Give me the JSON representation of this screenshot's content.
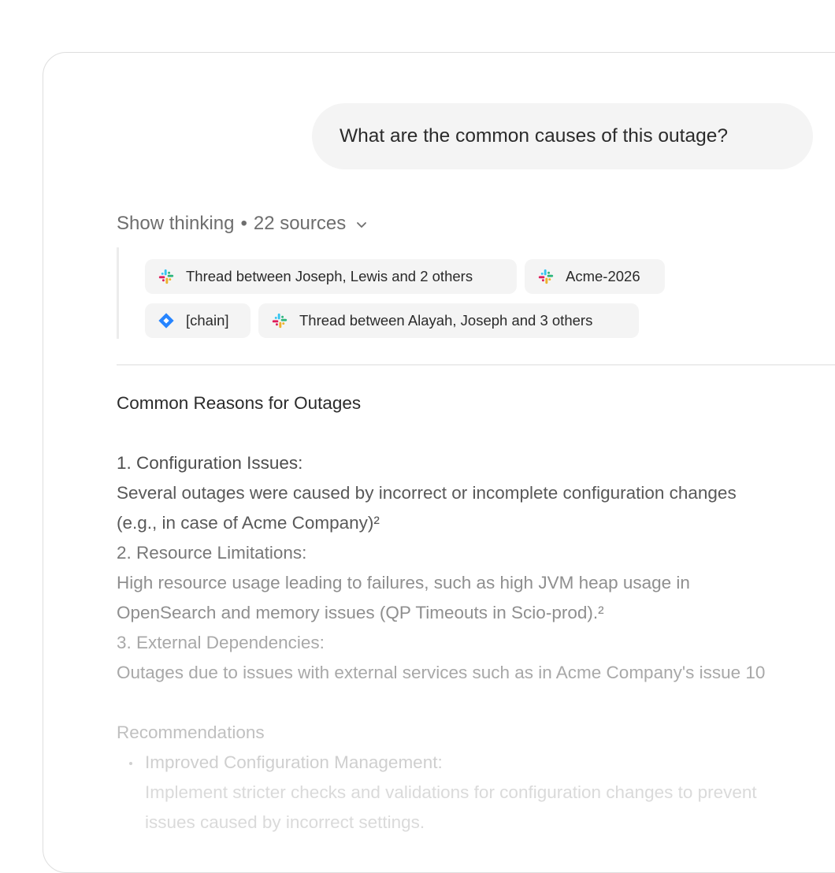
{
  "user_message": "What are the common causes of this outage?",
  "thinking": {
    "label": "Show thinking",
    "separator": "•",
    "sources_count": "22 sources"
  },
  "sources": [
    {
      "label": "Thread between Joseph, Lewis and 2 others",
      "icon": "slack-icon"
    },
    {
      "label": "Acme-2026",
      "icon": "slack-icon"
    },
    {
      "label": "[chain]",
      "icon": "jira-icon"
    },
    {
      "label": "Thread between Alayah, Joseph and 3 others",
      "icon": "slack-icon"
    }
  ],
  "answer": {
    "heading": "Common Reasons for Outages",
    "items": [
      {
        "title": "1. Configuration Issues:",
        "body_line1": " Several outages were caused by incorrect or incomplete configuration changes",
        "body_line2": "(e.g., in case of Acme Company)²"
      },
      {
        "title": "2. Resource Limitations:",
        "body_line1": " High resource usage leading to failures, such as high JVM heap usage in",
        "body_line2": "OpenSearch and memory issues (QP Timeouts in Scio-prod).²"
      },
      {
        "title": "3. External Dependencies:",
        "body_line1": " Outages due to issues with external services such as in Acme Company's issue 10"
      }
    ],
    "recommendations": {
      "heading": "Recommendations",
      "bullets": [
        {
          "title": "Improved Configuration Management:",
          "body_line1": " Implement stricter checks and validations for configuration changes to prevent",
          "body_line2": "issues caused by incorrect settings."
        }
      ]
    }
  },
  "colors": {
    "bubble_bg": "#f4f4f4",
    "chip_bg": "#f4f4f4",
    "card_border": "#dedede",
    "jira_blue": "#2684ff"
  }
}
